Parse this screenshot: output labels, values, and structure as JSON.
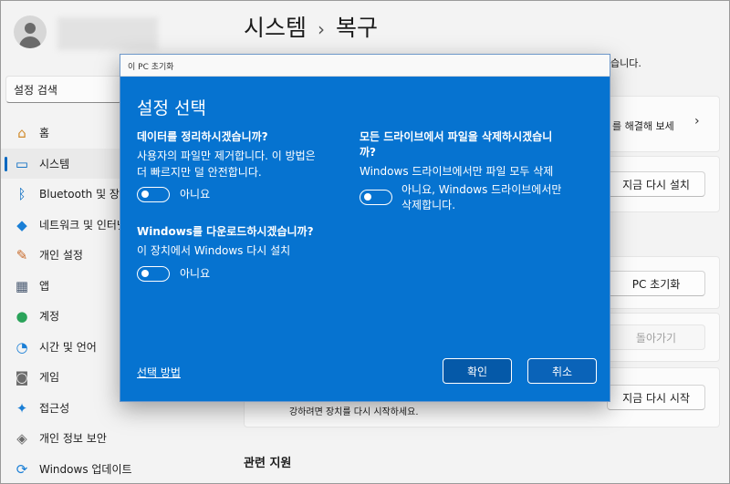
{
  "search": {
    "value": "설정 검색"
  },
  "nav": {
    "items": [
      {
        "label": "홈",
        "icon": "home-icon",
        "glyph": "⌂",
        "color": "#d08a2a"
      },
      {
        "label": "시스템",
        "icon": "monitor-icon",
        "glyph": "▭",
        "color": "#0067c0",
        "active": true
      },
      {
        "label": "Bluetooth 및 장치",
        "icon": "bluetooth-icon",
        "glyph": "ᛒ",
        "color": "#0067c0"
      },
      {
        "label": "네트워크 및 인터넷",
        "icon": "wifi-icon",
        "glyph": "◆",
        "color": "#1a7fd6"
      },
      {
        "label": "개인 설정",
        "icon": "brush-icon",
        "glyph": "✎",
        "color": "#c86a2a"
      },
      {
        "label": "앱",
        "icon": "apps-icon",
        "glyph": "▦",
        "color": "#4a5a72"
      },
      {
        "label": "계정",
        "icon": "account-icon",
        "glyph": "●",
        "color": "#2aa35a"
      },
      {
        "label": "시간 및 언어",
        "icon": "globe-clock-icon",
        "glyph": "◔",
        "color": "#1a7fd6"
      },
      {
        "label": "게임",
        "icon": "gamepad-icon",
        "glyph": "◙",
        "color": "#6b6b6b"
      },
      {
        "label": "접근성",
        "icon": "accessibility-icon",
        "glyph": "✦",
        "color": "#1a7fd6"
      },
      {
        "label": "개인 정보 보안",
        "icon": "shield-icon",
        "glyph": "◈",
        "color": "#6b6b6b"
      },
      {
        "label": "Windows 업데이트",
        "icon": "update-icon",
        "glyph": "⟳",
        "color": "#1a7fd6"
      }
    ]
  },
  "header": {
    "parent": "시스템",
    "separator": "›",
    "current": "복구"
  },
  "background": {
    "top_text": "습니다.",
    "troubleshoot_text": "를 해결해 보세",
    "reinstall_button": "지금 다시 설치",
    "reset_pc_button": "PC 초기화",
    "go_back_button": "돌아가기",
    "restart_text": "강하려면 장치를 다시 시작하세요.",
    "restart_button": "지금 다시 시작",
    "related_support": "관련 지원"
  },
  "dialog": {
    "window_title": "이 PC 초기화",
    "heading": "설정 선택",
    "clean_data": {
      "question": "데이터를 정리하시겠습니까?",
      "description_line1": "사용자의 파일만 제거합니다. 이 방법은",
      "description_line2": "더 빠르지만 덜 안전합니다.",
      "toggle_label": "아니요"
    },
    "download_windows": {
      "question": "Windows를 다운로드하시겠습니까?",
      "description": "이 장치에서 Windows 다시 설치",
      "toggle_label": "아니요"
    },
    "delete_all_drives": {
      "question_line1": "모든 드라이브에서 파일을 삭제하시겠습니",
      "question_line2": "까?",
      "description": "Windows 드라이브에서만 파일 모두 삭제",
      "toggle_label_line1": "아니요, Windows 드라이브에서만",
      "toggle_label_line2": "삭제합니다."
    },
    "choose_link": "선택 방법",
    "confirm_button": "확인",
    "cancel_button": "취소"
  }
}
